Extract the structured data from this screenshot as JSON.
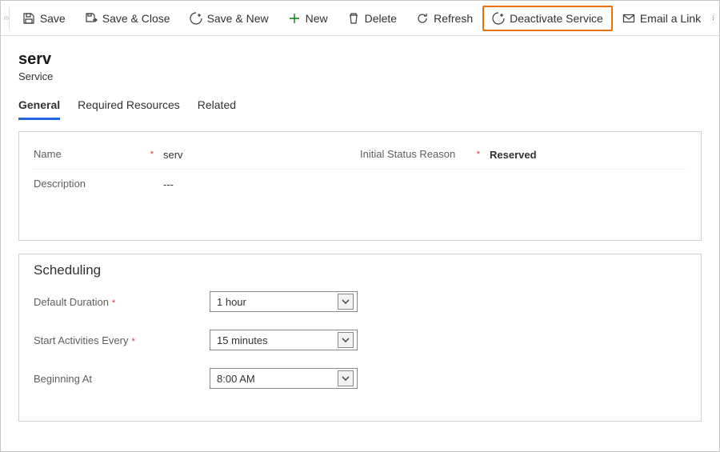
{
  "toolbar": {
    "save": "Save",
    "save_close": "Save & Close",
    "save_new": "Save & New",
    "new": "New",
    "delete": "Delete",
    "refresh": "Refresh",
    "deactivate": "Deactivate Service",
    "email_link": "Email a Link"
  },
  "header": {
    "title": "serv",
    "subtitle": "Service"
  },
  "tabs": {
    "general": "General",
    "required_resources": "Required Resources",
    "related": "Related"
  },
  "form": {
    "name_label": "Name",
    "name_value": "serv",
    "status_label": "Initial Status Reason",
    "status_value": "Reserved",
    "description_label": "Description",
    "description_value": "---"
  },
  "scheduling": {
    "title": "Scheduling",
    "default_duration_label": "Default Duration",
    "default_duration_value": "1 hour",
    "start_every_label": "Start Activities Every",
    "start_every_value": "15 minutes",
    "beginning_at_label": "Beginning At",
    "beginning_at_value": "8:00 AM"
  }
}
